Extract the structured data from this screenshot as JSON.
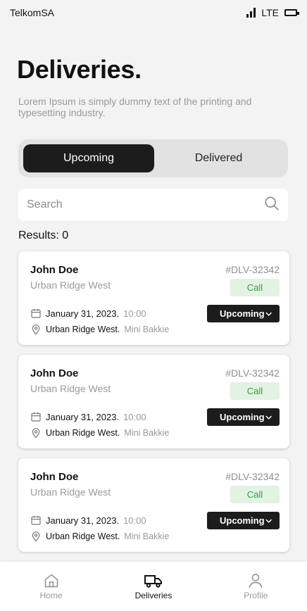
{
  "status_bar": {
    "carrier": "TelkomSA",
    "network": "LTE"
  },
  "header": {
    "title": "Deliveries.",
    "description": "Lorem Ipsum is simply dummy text of the printing and typesetting industry."
  },
  "tabs": [
    {
      "label": "Upcoming",
      "active": true
    },
    {
      "label": "Delivered",
      "active": false
    }
  ],
  "search": {
    "placeholder": "Search",
    "value": ""
  },
  "results": {
    "label": "Results: 0"
  },
  "deliveries": [
    {
      "name": "John Doe",
      "area": "Urban Ridge West",
      "ref": "#DLV-32342",
      "call_label": "Call",
      "date": "January 31, 2023.",
      "time": "10:00",
      "location": "Urban Ridge West.",
      "vehicle": "Mini Bakkie",
      "status": "Upcoming"
    },
    {
      "name": "John Doe",
      "area": "Urban Ridge West",
      "ref": "#DLV-32342",
      "call_label": "Call",
      "date": "January 31, 2023.",
      "time": "10:00",
      "location": "Urban Ridge West.",
      "vehicle": "Mini Bakkie",
      "status": "Upcoming"
    },
    {
      "name": "John Doe",
      "area": "Urban Ridge West",
      "ref": "#DLV-32342",
      "call_label": "Call",
      "date": "January 31, 2023.",
      "time": "10:00",
      "location": "Urban Ridge West.",
      "vehicle": "Mini Bakkie",
      "status": "Upcoming"
    }
  ],
  "nav": [
    {
      "label": "Home",
      "icon": "home-icon",
      "active": false
    },
    {
      "label": "Deliveries",
      "icon": "truck-icon",
      "active": true
    },
    {
      "label": "Profile",
      "icon": "user-icon",
      "active": false
    }
  ],
  "colors": {
    "accent": "#1c1c1c",
    "call_bg": "#e2f2e3",
    "call_text": "#3a9b48"
  }
}
